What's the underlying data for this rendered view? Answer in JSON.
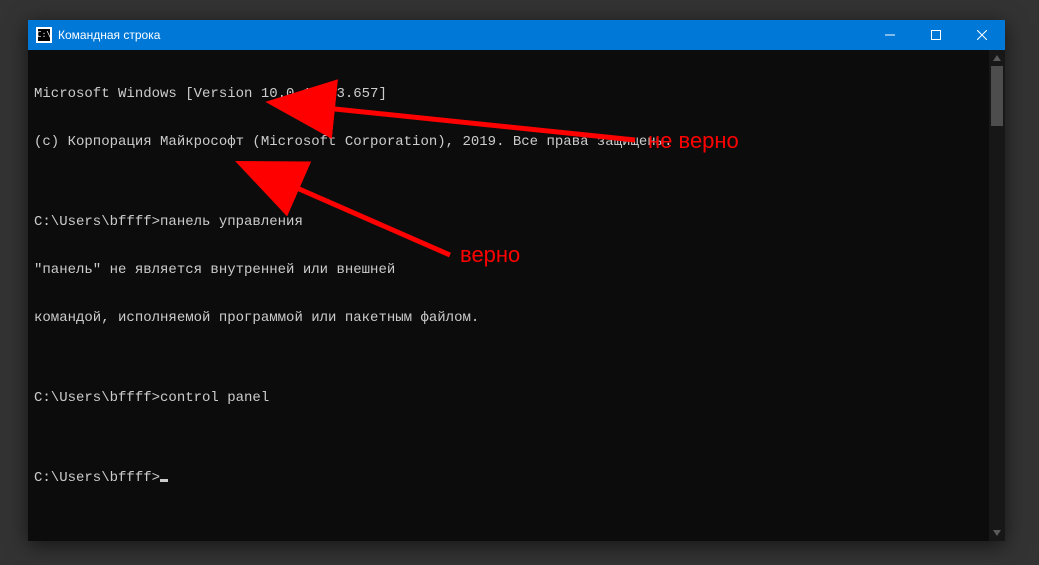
{
  "window": {
    "title": "Командная строка",
    "icon_glyph": "C:\\"
  },
  "terminal": {
    "lines": [
      "Microsoft Windows [Version 10.0.18363.657]",
      "(c) Корпорация Майкрософт (Microsoft Corporation), 2019. Все права защищены.",
      "",
      "C:\\Users\\bffff>панель управления",
      "\"панель\" не является внутренней или внешней",
      "командой, исполняемой программой или пакетным файлом.",
      "",
      "C:\\Users\\bffff>control panel",
      "",
      "C:\\Users\\bffff>"
    ]
  },
  "annotations": {
    "wrong": "не верно",
    "correct": "верно"
  }
}
